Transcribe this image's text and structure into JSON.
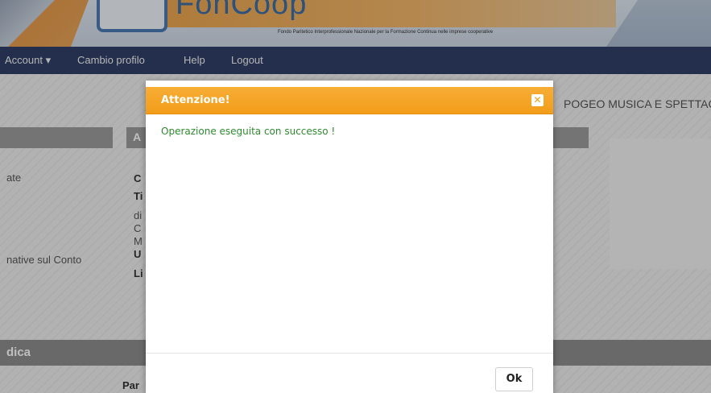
{
  "banner": {
    "logo_text": "FonCoop",
    "tagline": "Fondo Paritetico Interprofessionale Nazionale per la Formazione Continua nelle imprese cooperative"
  },
  "nav": {
    "items": [
      {
        "label": "Account ▾"
      },
      {
        "label": "Cambio profilo"
      },
      {
        "label": "Help"
      },
      {
        "label": "Logout"
      }
    ]
  },
  "background": {
    "org_name": "POGEO MUSICA E SPETTAC",
    "left_fragments": [
      "ate",
      "native sul Conto"
    ],
    "section_header": "dica",
    "bottom_label": "Par",
    "middle_fragments": [
      "A",
      "C",
      "Ti",
      "di",
      "C",
      "M",
      "U",
      "Li"
    ]
  },
  "modal": {
    "title": "Attenzione!",
    "close_icon": "close-icon",
    "message": "Operazione eseguita con successo !",
    "ok_label": "Ok"
  },
  "colors": {
    "header_orange": "#f5a623",
    "nav_dark_blue": "#2f3f66",
    "success_green": "#2f8a2f"
  }
}
